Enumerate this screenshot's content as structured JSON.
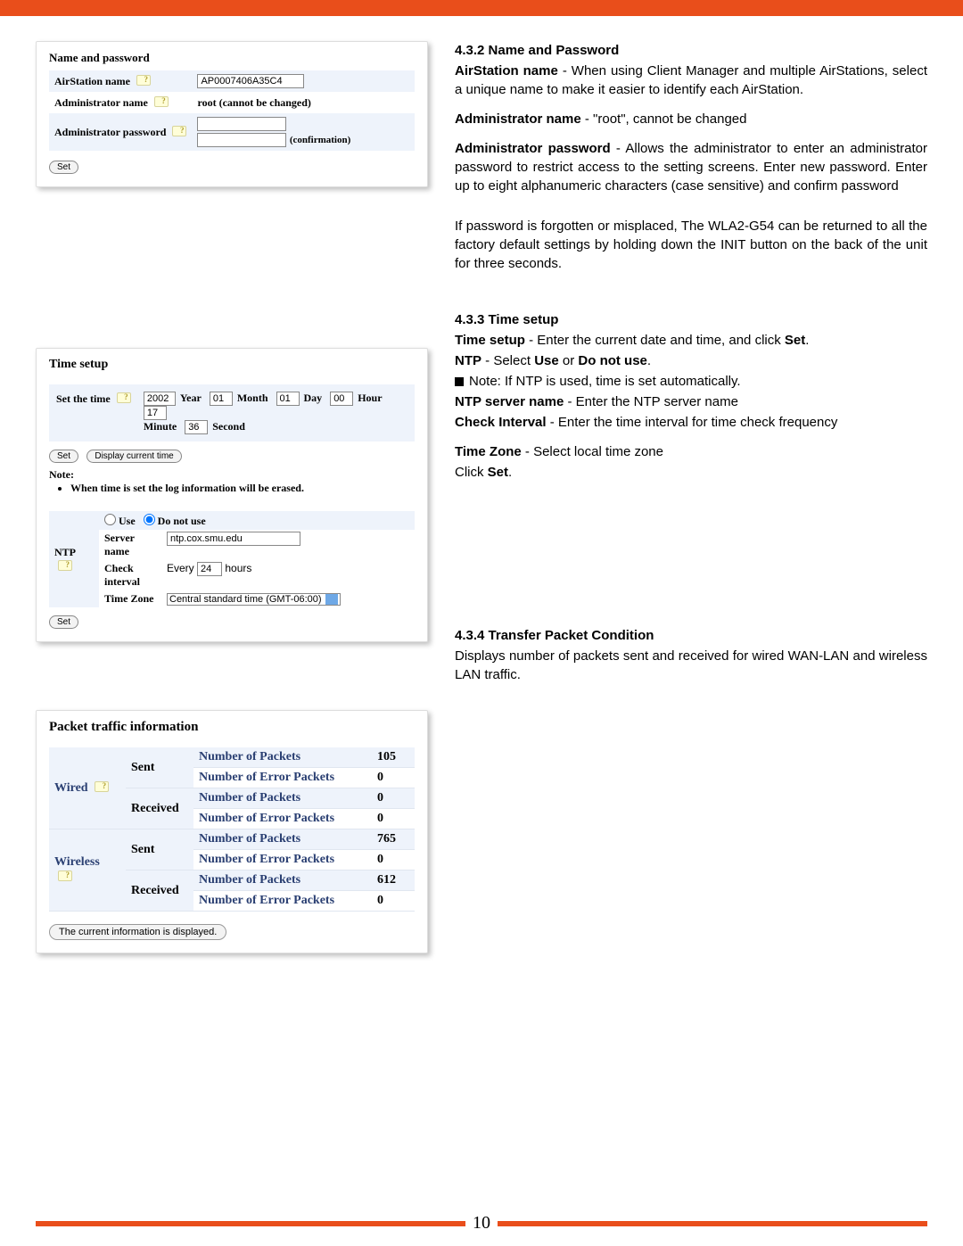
{
  "page_number": "10",
  "sections": {
    "name_password": {
      "heading": "4.3.2 Name and Password",
      "p1_bold": "AirStation name",
      "p1_rest": " - When using Client Manager and multiple AirStations, select a unique name to make it easier to identify each AirStation.",
      "p2_bold": "Administrator name",
      "p2_rest": " - \"root\", cannot be changed",
      "p3_bold": "Administrator password",
      "p3_rest": " - Allows the administrator to enter an administrator password to restrict access to the setting screens. Enter new password.  Enter up to eight alphanumeric characters (case sensitive) and confirm password",
      "p4": "If password is forgotten or misplaced, The WLA2-G54 can be returned to all the factory default settings by holding down the INIT button on the back of the unit for three seconds."
    },
    "time_setup": {
      "heading": "4.3.3 Time setup",
      "p1_bold": "Time setup",
      "p1_rest": " - Enter the current date and time, and click ",
      "p1_bold2": "Set",
      "p1_end": ".",
      "ntp_bold": "NTP",
      "ntp_mid": " - Select ",
      "ntp_use": "Use",
      "ntp_or": " or ",
      "ntp_dnu": "Do not use",
      "ntp_end": ".",
      "note": "Note: If NTP is used, time is set automatically.",
      "server_bold": "NTP server name",
      "server_rest": " - Enter the NTP server name",
      "check_bold": "Check Interval",
      "check_rest": " - Enter the time interval for time check frequency",
      "tz_bold": "Time Zone",
      "tz_rest": " - Select local time zone",
      "click": "Click ",
      "click_set": "Set",
      "click_end": "."
    },
    "transfer": {
      "heading": "4.3.4 Transfer Packet Condition",
      "p1": "Displays number of packets sent and received for wired WAN-LAN and wireless LAN traffic."
    }
  },
  "panel_np": {
    "title": "Name and password",
    "rows": {
      "airstation_label": "AirStation name",
      "airstation_value": "AP0007406A35C4",
      "adminname_label": "Administrator name",
      "adminname_value": "root (cannot be changed)",
      "adminpass_label": "Administrator password",
      "confirmation_label": "(confirmation)"
    },
    "set_btn": "Set"
  },
  "panel_ts": {
    "title": "Time setup",
    "set_the_time": "Set the time",
    "year_val": "2002",
    "year_lbl": "Year",
    "month_val": "01",
    "month_lbl": "Month",
    "day_val": "01",
    "day_lbl": "Day",
    "hour_val": "00",
    "hour_lbl": "Hour",
    "minute_val": "17",
    "minute_lbl": "Minute",
    "second_val": "36",
    "second_lbl": "Second",
    "set_btn": "Set",
    "display_btn": "Display current time",
    "note_label": "Note:",
    "note_item": "When time is set the log information will be erased.",
    "ntp_label": "NTP",
    "use_label": "Use",
    "donotuse_label": "Do not use",
    "server_label": "Server name",
    "server_value": "ntp.cox.smu.edu",
    "check_label": "Check interval",
    "every": "Every",
    "check_val": "24",
    "hours": "hours",
    "tz_label": "Time Zone",
    "tz_value": "Central standard time (GMT-06:00)",
    "set_btn2": "Set"
  },
  "panel_pk": {
    "title": "Packet traffic information",
    "hdr_num": "Number of Packets",
    "hdr_err": "Number of Error Packets",
    "wired": "Wired",
    "wireless": "Wireless",
    "sent": "Sent",
    "received": "Received",
    "vals": {
      "wired_sent_num": "105",
      "wired_sent_err": "0",
      "wired_recv_num": "0",
      "wired_recv_err": "0",
      "wl_sent_num": "765",
      "wl_sent_err": "0",
      "wl_recv_num": "612",
      "wl_recv_err": "0"
    },
    "footer_btn": "The current information is displayed."
  }
}
